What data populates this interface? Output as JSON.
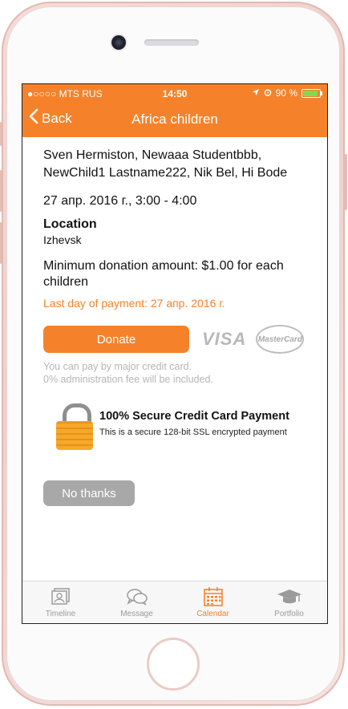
{
  "status_bar": {
    "carrier": "●○○○○ MTS RUS",
    "time": "14:50",
    "battery_text": "90 %"
  },
  "nav": {
    "back_label": "Back",
    "title": "Africa children"
  },
  "event": {
    "participants": "Sven Hermiston, Newaaa Studentbbb, NewChild1 Lastname222, Nik Bel, Hi Bode",
    "datetime": "27 апр. 2016 г., 3:00 - 4:00",
    "location_heading": "Location",
    "location_value": "Izhevsk",
    "min_donation": "Minimum donation amount: $1.00 for each children",
    "last_day": "Last day of payment: 27 апр. 2016 г."
  },
  "payment": {
    "donate_label": "Donate",
    "visa_text": "VISA",
    "mastercard_text": "MasterCard",
    "note_line1": "You can pay by major credit card.",
    "note_line2": "0% administration fee will be included.",
    "secure_title": "100% Secure Credit Card Payment",
    "secure_subtitle": "This is a secure 128-bit SSL encrypted payment",
    "no_thanks_label": "No thanks"
  },
  "tabbar": {
    "tabs": [
      {
        "label": "Timeline",
        "icon": "timeline-icon"
      },
      {
        "label": "Message",
        "icon": "message-icon"
      },
      {
        "label": "Calendar",
        "icon": "calendar-icon",
        "active": true
      },
      {
        "label": "Portfolio",
        "icon": "graduation-cap-icon"
      }
    ]
  },
  "colors": {
    "accent": "#f5822a",
    "muted_button": "#a8a8a8",
    "tab_inactive": "#9a9a9a"
  }
}
